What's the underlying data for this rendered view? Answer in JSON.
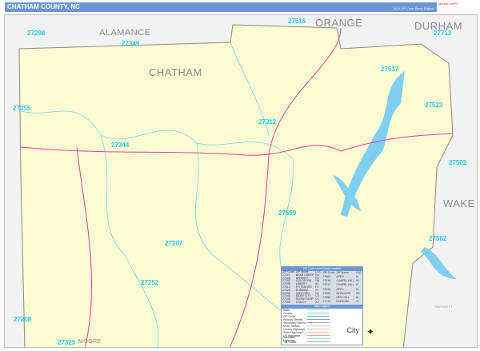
{
  "header": {
    "title": "CHATHAM COUNTY, NC",
    "edition": "2023 ZIP Code Basic Edition",
    "logo": "Market MAPS"
  },
  "counties": {
    "alamance": "ALAMANCE",
    "orange": "ORANGE",
    "durham": "DURHAM",
    "chatham": "CHATHAM",
    "wake": "WAKE",
    "moore": "MOORE",
    "harnett": "HARNETT"
  },
  "zips": [
    "27298",
    "27349",
    "27516",
    "27713",
    "27517",
    "27523",
    "27355",
    "27312",
    "27344",
    "27502",
    "27559",
    "27562",
    "27207",
    "27252",
    "27208",
    "27325"
  ],
  "legend": {
    "title": "ZIP Code Index/Town Location",
    "headers": [
      "ZIP Code",
      "ZIP Name",
      "LOC"
    ],
    "left": [
      [
        "27207",
        "BEAR CREEK",
        "D6"
      ],
      [
        "27208",
        "BENNETT",
        "E6"
      ],
      [
        "27252",
        "GOLDSTON",
        "G6"
      ],
      [
        "27298",
        "LIBERTY",
        "A1"
      ],
      [
        "27312",
        "PITTSBORO",
        "F3"
      ],
      [
        "27325",
        "ROBBINS",
        "E7"
      ],
      [
        "27330",
        "SANFORD",
        "H7"
      ],
      [
        "27344",
        "SILER CITY",
        "C3"
      ],
      [
        "27349",
        "SNOW CAMP",
        "C1"
      ],
      [
        "27355",
        "STALEY",
        "A2"
      ]
    ],
    "right": [
      [
        "27502",
        "APEX",
        "I4"
      ],
      [
        "27516",
        "CHAPEL HILL",
        "H1"
      ],
      [
        "27517",
        "CHAPEL HILL",
        "I2"
      ],
      [
        "27523",
        "APEX",
        "I3"
      ],
      [
        "27559",
        "MONCURE",
        "G5"
      ],
      [
        "27562",
        "NEW HILL",
        "I5"
      ],
      [
        "27713",
        "DURHAM",
        "J1"
      ]
    ],
    "key_title": "Map Legend",
    "lines": [
      "State",
      "County",
      "ZIP Code",
      "Primary Streets",
      "Secondary Streets",
      "Minor Streets",
      "County Highways",
      "State Highways",
      "US Highways",
      "Interstate Highways",
      "Toll Roads"
    ],
    "city": "City"
  },
  "colors": {
    "land": "#fdfbd2",
    "water": "#7fcff0",
    "zip": "#27c6f0",
    "highway": "#e0409a",
    "header": "#6a96d6"
  }
}
